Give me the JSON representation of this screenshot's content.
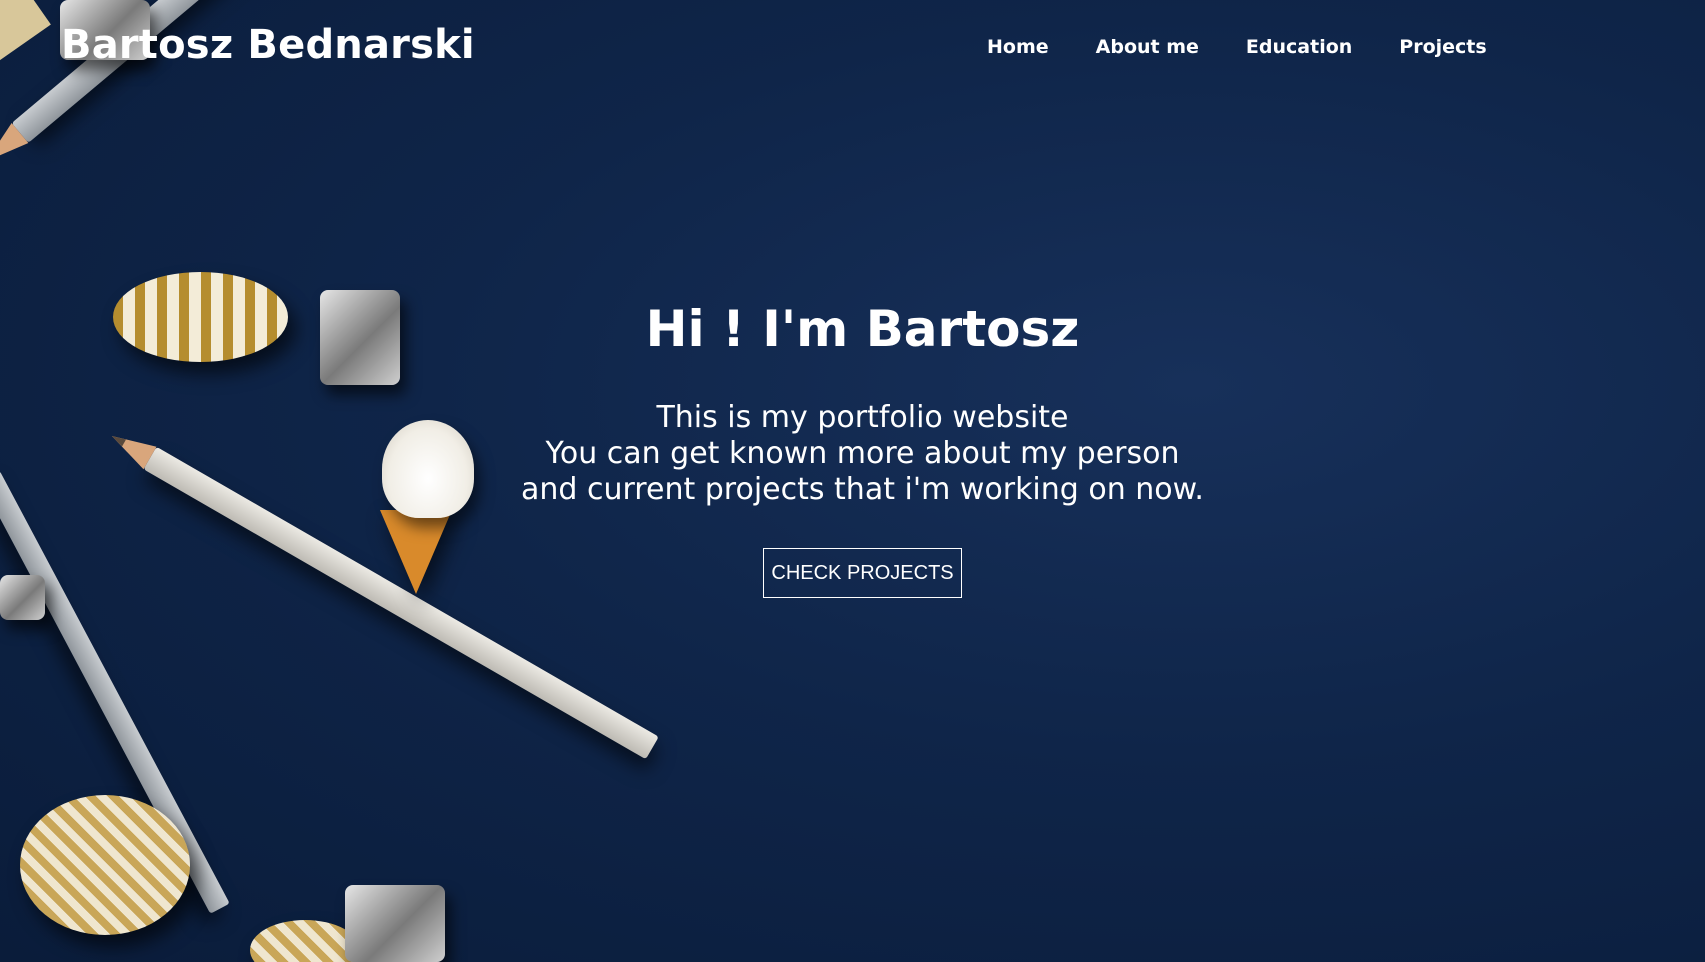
{
  "header": {
    "title": "Bartosz Bednarski",
    "nav": [
      {
        "label": "Home"
      },
      {
        "label": "About me"
      },
      {
        "label": "Education"
      },
      {
        "label": "Projects"
      }
    ]
  },
  "hero": {
    "headline": "Hi ! I'm Bartosz",
    "intro_lines": [
      "This is my portfolio website",
      "You can get known more about my person",
      "and current projects that i'm working on now."
    ],
    "cta_label": "CHECK PROJECTS",
    "background": "dark navy desk with pencils, washi tape, binder clips and ice-cream eraser"
  },
  "colors": {
    "background": "#0f2549",
    "text": "#ffffff"
  }
}
